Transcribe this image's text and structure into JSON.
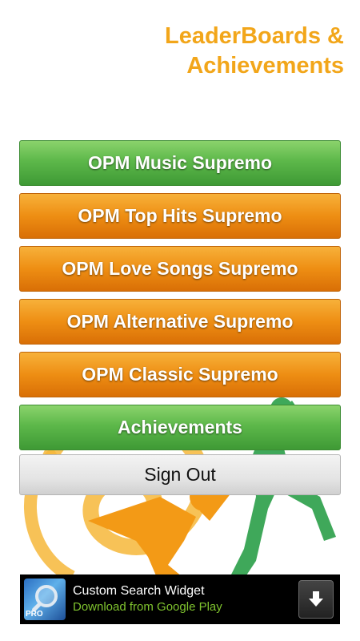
{
  "header": {
    "title_line1": "LeaderBoards &",
    "title_line2": "Achievements"
  },
  "menu": {
    "buttons": [
      {
        "label": "OPM Music Supremo",
        "style": "green"
      },
      {
        "label": "OPM Top Hits Supremo",
        "style": "orange"
      },
      {
        "label": "OPM Love Songs Supremo",
        "style": "orange"
      },
      {
        "label": "OPM Alternative Supremo",
        "style": "orange"
      },
      {
        "label": "OPM Classic Supremo",
        "style": "orange"
      },
      {
        "label": "Achievements",
        "style": "green"
      }
    ],
    "sign_out_label": "Sign Out"
  },
  "ad": {
    "app_name": "Custom Search Widget",
    "subtitle": "Download from Google Play",
    "icon_badge": "PRO",
    "icon": "magnifier-icon",
    "action_icon": "download-arrow-icon"
  },
  "colors": {
    "accent_orange": "#F2A61A",
    "button_green": "#5DB84A",
    "button_orange": "#EE8E13",
    "ad_link_green": "#7FC32E",
    "dancer_green": "#3FA85A",
    "dancer_orange": "#F39A16"
  }
}
